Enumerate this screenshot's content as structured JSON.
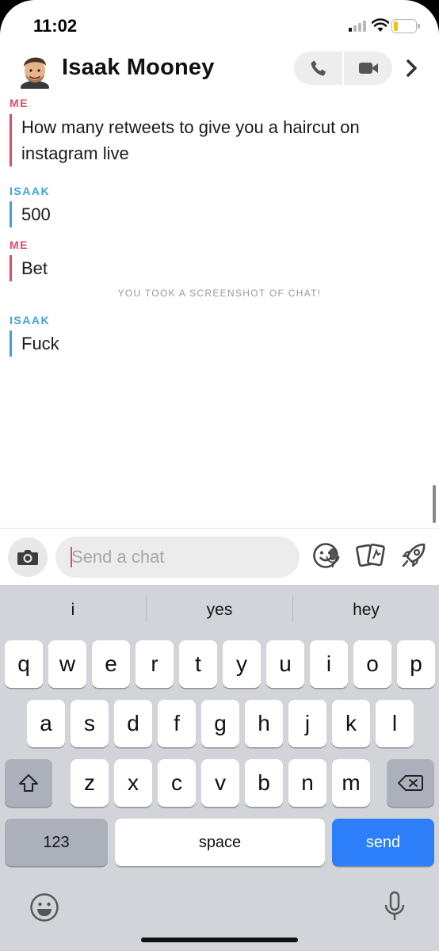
{
  "status": {
    "time": "11:02"
  },
  "header": {
    "name": "Isaak Mooney"
  },
  "messages": [
    {
      "sender": "ME",
      "text": "How many retweets to give you a haircut on instagram live"
    },
    {
      "sender": "ISAAK",
      "text": "500"
    },
    {
      "sender": "ME",
      "text": "Bet"
    },
    {
      "sender": "ISAAK",
      "text": "Fuck"
    }
  ],
  "notice": "YOU TOOK A SCREENSHOT OF CHAT!",
  "composer": {
    "placeholder": "Send a chat"
  },
  "keyboard": {
    "suggestions": [
      "i",
      "yes",
      "hey"
    ],
    "row1": [
      "q",
      "w",
      "e",
      "r",
      "t",
      "y",
      "u",
      "i",
      "o",
      "p"
    ],
    "row2": [
      "a",
      "s",
      "d",
      "f",
      "g",
      "h",
      "j",
      "k",
      "l"
    ],
    "row3": [
      "z",
      "x",
      "c",
      "v",
      "b",
      "n",
      "m"
    ],
    "numbers": "123",
    "space": "space",
    "send": "send"
  },
  "colors": {
    "me": "#e04d63",
    "them": "#3da1e0",
    "send": "#2d7ff9"
  },
  "icons": [
    "phone-icon",
    "video-icon",
    "chevron-right-icon",
    "camera-icon",
    "microphone-icon",
    "smiley-icon",
    "cards-icon",
    "rocket-icon",
    "shift-icon",
    "backspace-icon",
    "emoji-icon"
  ]
}
